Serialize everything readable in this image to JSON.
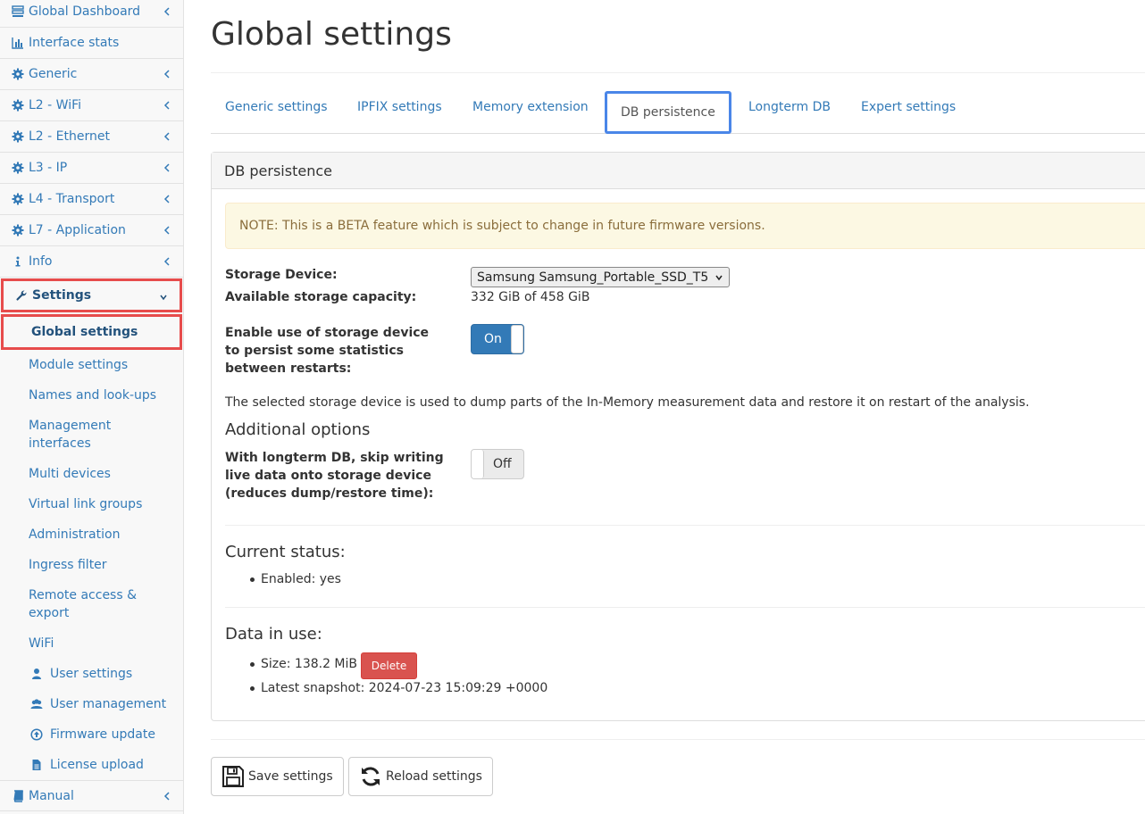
{
  "sidebar": {
    "items": [
      {
        "label": "Global Dashboard",
        "icon": "dashboard-icon"
      },
      {
        "label": "Interface stats",
        "icon": "bar-chart-icon"
      },
      {
        "label": "Generic",
        "icon": "gear-icon"
      },
      {
        "label": "L2 - WiFi",
        "icon": "gear-icon"
      },
      {
        "label": "L2 - Ethernet",
        "icon": "gear-icon"
      },
      {
        "label": "L3 - IP",
        "icon": "gear-icon"
      },
      {
        "label": "L4 - Transport",
        "icon": "gear-icon"
      },
      {
        "label": "L7 - Application",
        "icon": "gear-icon"
      },
      {
        "label": "Info",
        "icon": "info-icon"
      }
    ],
    "settings": {
      "label": "Settings",
      "icon": "wrench-icon"
    },
    "sub_items": [
      {
        "label": "Global settings"
      },
      {
        "label": "Module settings"
      },
      {
        "label": "Names and look-ups"
      },
      {
        "label": "Management"
      },
      {
        "label": "interfaces"
      },
      {
        "label": "Multi devices"
      },
      {
        "label": "Virtual link groups"
      },
      {
        "label": "Administration"
      },
      {
        "label": "Ingress filter"
      },
      {
        "label": "Remote access &"
      },
      {
        "label": "export"
      },
      {
        "label": "WiFi"
      },
      {
        "label": "User settings",
        "icon": "user-icon"
      },
      {
        "label": "User management",
        "icon": "users-icon"
      },
      {
        "label": "Firmware update",
        "icon": "upload-circle-icon"
      },
      {
        "label": "License upload",
        "icon": "file-icon"
      }
    ],
    "manual": {
      "label": "Manual",
      "icon": "book-icon"
    }
  },
  "page": {
    "title": "Global settings"
  },
  "tabs": [
    "Generic settings",
    "IPFIX settings",
    "Memory extension",
    "DB persistence",
    "Longterm DB",
    "Expert settings"
  ],
  "panel": {
    "heading": "DB persistence",
    "note": "NOTE: This is a BETA feature which is subject to change in future firmware versions.",
    "storage_device_label": "Storage Device:",
    "storage_device_value": "Samsung Samsung_Portable_SSD_T5",
    "capacity_label": "Available storage capacity:",
    "capacity_value": "332 GiB of 458 GiB",
    "enable_label_1": "Enable use of storage device",
    "enable_label_2": "to persist some statistics",
    "enable_label_3": "between restarts:",
    "enable_toggle": "On",
    "description": "The selected storage device is used to dump parts of the In-Memory measurement data and restore it on restart of the analysis.",
    "additional_heading": "Additional options",
    "skip_label_1": "With longterm DB, skip writing",
    "skip_label_2": "live data onto storage device",
    "skip_label_3": "(reduces dump/restore time):",
    "skip_toggle": "Off",
    "status_heading": "Current status:",
    "status_enabled": "Enabled: yes",
    "data_heading": "Data in use:",
    "size": "Size: 138.2 MiB",
    "delete_label": "Delete",
    "latest_snapshot": "Latest snapshot: 2024-07-23 15:09:29 +0000"
  },
  "actions": {
    "save": "Save settings",
    "reload": "Reload settings"
  },
  "colors": {
    "link": "#337ab7",
    "highlight": "#e74c4c",
    "active_tab_border": "#4a86e8",
    "primary": "#337ab7",
    "danger": "#d9534f",
    "note_bg": "#fcf8e3"
  }
}
